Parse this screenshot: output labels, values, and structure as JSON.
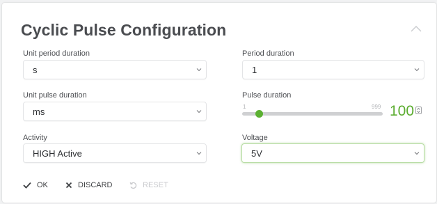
{
  "panel": {
    "title": "Cyclic Pulse Configuration"
  },
  "fields": {
    "unit_period_duration": {
      "label": "Unit period duration",
      "value": "s"
    },
    "period_duration": {
      "label": "Period duration",
      "value": "1"
    },
    "unit_pulse_duration": {
      "label": "Unit pulse duration",
      "value": "ms"
    },
    "pulse_duration": {
      "label": "Pulse duration",
      "slider_min": "1",
      "slider_max": "999",
      "value": "100",
      "level_fraction": 0.1
    },
    "activity": {
      "label": "Activity",
      "value": "HIGH Active"
    },
    "voltage": {
      "label": "Voltage",
      "value": "5V"
    }
  },
  "actions": {
    "ok": "OK",
    "discard": "DISCARD",
    "reset": "RESET"
  },
  "colors": {
    "accent": "#5aac2e",
    "title": "#4a4c50",
    "disabled": "#c9cacd"
  },
  "icons": {
    "collapse": "chevron-up-icon",
    "select": "chevron-down-icon",
    "ok": "check-icon",
    "discard": "x-icon",
    "reset": "undo-icon",
    "spinner": "spinner-arrows-icon"
  }
}
